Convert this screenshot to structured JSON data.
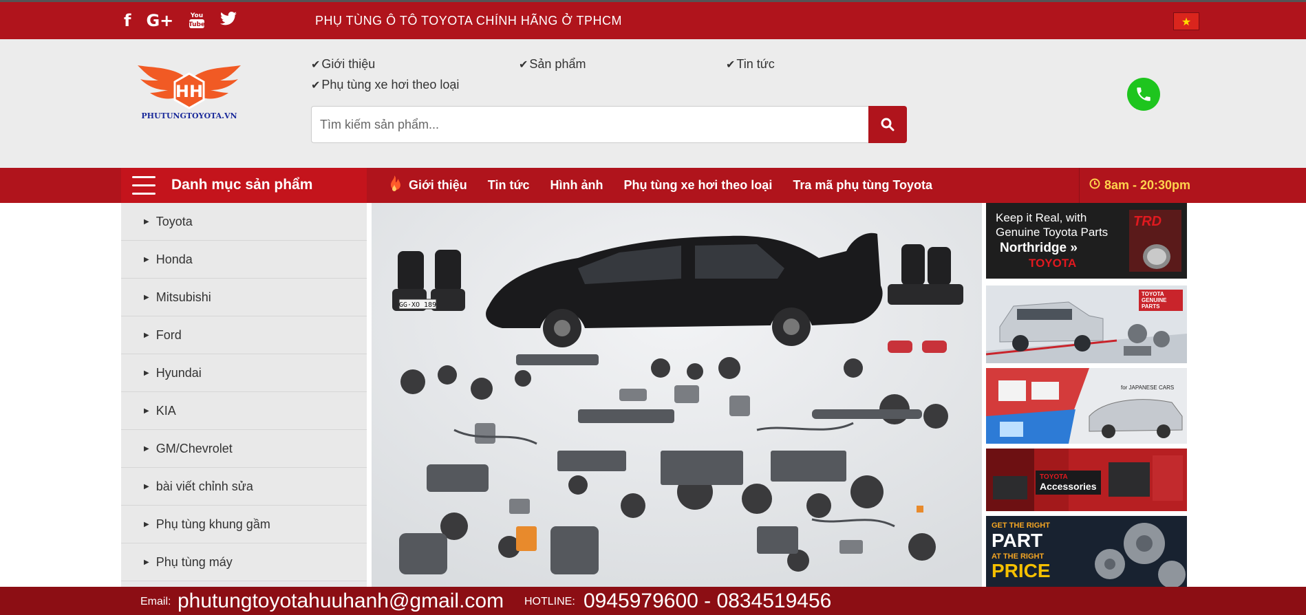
{
  "topbar": {
    "social_icons": [
      "facebook-icon",
      "google-plus-icon",
      "youtube-icon",
      "twitter-icon"
    ],
    "social_glyphs": {
      "facebook": "f",
      "google": "G+",
      "youtube": "You",
      "twitter": "🐦"
    },
    "tagline": "PHỤ TÙNG Ô TÔ TOYOTA CHÍNH HÃNG Ở TPHCM",
    "flag_star": "★"
  },
  "logo": {
    "initials": "HH",
    "name": "PHUTUNGTOYOTA.VN"
  },
  "header_menu": [
    {
      "label": "Giới thiệu"
    },
    {
      "label": "Sản phẩm"
    },
    {
      "label": "Tin tức"
    },
    {
      "label": "Phụ tùng xe hơi theo loại"
    }
  ],
  "search": {
    "placeholder": "Tìm kiếm sản phẩm..."
  },
  "nav": {
    "category_label": "Danh mục sản phẩm",
    "links": [
      "Giới thiệu",
      "Tin tức",
      "Hình ảnh",
      "Phụ tùng xe hơi theo loại",
      "Tra mã phụ tùng Toyota"
    ],
    "hours": "8am - 20:30pm"
  },
  "categories": [
    "Toyota",
    "Honda",
    "Mitsubishi",
    "Ford",
    "Hyundai",
    "KIA",
    "GM/Chevrolet",
    "bài viết chỉnh sửa",
    "Phụ tùng khung gầm",
    "Phụ tùng máy"
  ],
  "hero": {
    "plate": "GG·XO 189"
  },
  "banners": {
    "b1": {
      "line1": "Keep it Real, with",
      "line2": "Genuine Toyota Parts",
      "line3": "Northridge »",
      "line4": "TOYOTA",
      "badge": "TRD"
    },
    "b2": {
      "badge": "TOYOTA GENUINE PARTS"
    },
    "b3": {
      "caption": "for JAPANESE CARS"
    },
    "b4": {
      "line1": "TOYOTA",
      "line2": "Accessories"
    },
    "b5": {
      "line1": "GET THE RIGHT",
      "line2": "PART",
      "line3": "AT THE RIGHT",
      "line4": "PRICE"
    }
  },
  "footer": {
    "email_label": "Email:",
    "email": "phutungtoyotahuuhanh@gmail.com",
    "hotline_label": "HOTLINE:",
    "hotline": "0945979600 - 0834519456"
  },
  "colors": {
    "brand_red": "#b0141c",
    "footer_red": "#8c0e14",
    "phone_green": "#1ec51e",
    "hours_yellow": "#ffd34d"
  }
}
